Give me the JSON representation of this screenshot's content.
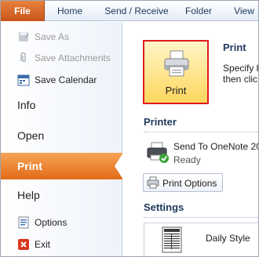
{
  "ribbon": {
    "tabs": [
      "File",
      "Home",
      "Send / Receive",
      "Folder",
      "View"
    ]
  },
  "nav": {
    "save_as": "Save As",
    "save_attachments": "Save Attachments",
    "save_calendar": "Save Calendar",
    "info": "Info",
    "open": "Open",
    "print": "Print",
    "help": "Help",
    "options": "Options",
    "exit": "Exit"
  },
  "main": {
    "print_button_label": "Print",
    "print_heading": "Print",
    "print_desc_line1": "Specify h",
    "print_desc_line2": "then clic",
    "printer_heading": "Printer",
    "printer_name": "Send To OneNote 20",
    "printer_status": "Ready",
    "print_options_label": "Print Options",
    "settings_heading": "Settings",
    "style_label": "Daily Style"
  },
  "colors": {
    "file_tab": "#d0612a",
    "selected_nav": "#e26b18",
    "highlight_border": "#e01b1b",
    "heading_text": "#1e395b"
  }
}
